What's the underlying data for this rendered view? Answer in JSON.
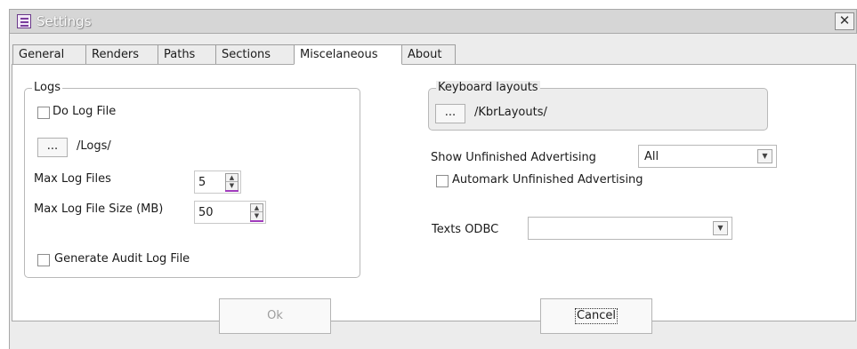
{
  "window": {
    "title": "Settings",
    "close_glyph": "✕"
  },
  "tabs": [
    {
      "label": "General"
    },
    {
      "label": "Renders"
    },
    {
      "label": "Paths"
    },
    {
      "label": "Sections"
    },
    {
      "label": "Miscelaneous"
    },
    {
      "label": "About"
    }
  ],
  "active_tab": "Miscelaneous",
  "logs": {
    "group_label": "Logs",
    "do_log_file": {
      "label": "Do Log File",
      "checked": false
    },
    "path_button": "...",
    "path": "/Logs/",
    "max_log_files": {
      "label": "Max Log Files",
      "value": "5"
    },
    "max_log_size": {
      "label": "Max Log File Size (MB)",
      "value": "50"
    },
    "audit": {
      "label": "Generate Audit Log File",
      "checked": false
    }
  },
  "keyboard": {
    "group_label": "Keyboard layouts",
    "path_button": "...",
    "path": "/KbrLayouts/"
  },
  "advertising": {
    "label": "Show Unfinished Advertising",
    "value": "All",
    "automark": {
      "label": "Automark Unfinished Advertising",
      "checked": false
    }
  },
  "odbc": {
    "label": "Texts ODBC",
    "value": ""
  },
  "buttons": {
    "ok": "Ok",
    "cancel": "Cancel"
  },
  "icons": {
    "window_icon": "settings-list-icon",
    "dropdown": "chevron-down-icon",
    "spinner": "spin-arrows-icon"
  }
}
